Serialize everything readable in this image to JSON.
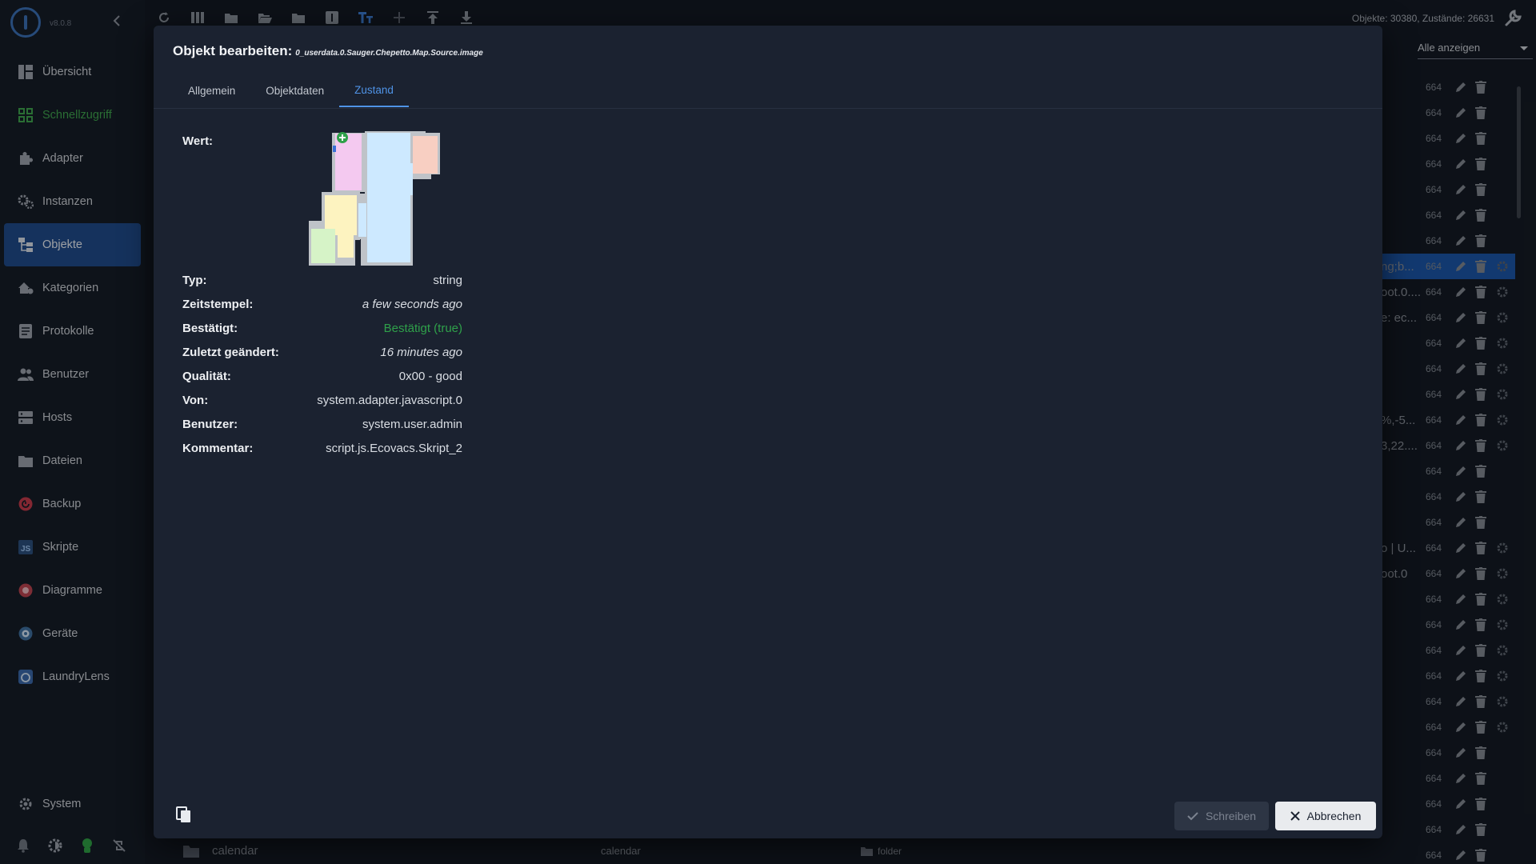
{
  "app": {
    "version": "v8.0.8"
  },
  "sidebar": {
    "items": [
      {
        "label": "Übersicht",
        "icon": "dashboard-icon"
      },
      {
        "label": "Schnellzugriff",
        "icon": "grid-icon"
      },
      {
        "label": "Adapter",
        "icon": "puzzle-icon"
      },
      {
        "label": "Instanzen",
        "icon": "gears-icon"
      },
      {
        "label": "Objekte",
        "icon": "tree-icon"
      },
      {
        "label": "Kategorien",
        "icon": "home-category-icon"
      },
      {
        "label": "Protokolle",
        "icon": "log-icon"
      },
      {
        "label": "Benutzer",
        "icon": "users-icon"
      },
      {
        "label": "Hosts",
        "icon": "server-icon"
      },
      {
        "label": "Dateien",
        "icon": "folder-icon"
      },
      {
        "label": "Backup",
        "icon": "backup-icon"
      },
      {
        "label": "Skripte",
        "icon": "js-icon"
      },
      {
        "label": "Diagramme",
        "icon": "chart-icon"
      },
      {
        "label": "Geräte",
        "icon": "devices-icon"
      },
      {
        "label": "LaundryLens",
        "icon": "laundry-icon"
      }
    ],
    "system_label": "System"
  },
  "header": {
    "stats": "Objekte: 30380, Zustände: 26631",
    "filter_value": "Alle anzeigen"
  },
  "rows": {
    "count_value": "664",
    "peeks": [
      "",
      "",
      "",
      "",
      "",
      "",
      "",
      "ng;b...",
      "oot.0....",
      "e: ec...",
      "",
      "",
      "",
      "%,-5...",
      "3,22....",
      "",
      "",
      "",
      "o | U...",
      "oot.0",
      "",
      "",
      "",
      "",
      "",
      "",
      "",
      "",
      "",
      "",
      ""
    ]
  },
  "bottom_row": {
    "name": "calendar",
    "role": "calendar",
    "type": "folder"
  },
  "dialog": {
    "title": "Objekt bearbeiten:",
    "object_id": "0_userdata.0.Sauger.Chepetto.Map.Source.image",
    "tabs": [
      "Allgemein",
      "Objektdaten",
      "Zustand"
    ],
    "active_tab": "Zustand",
    "value_label": "Wert:",
    "properties": [
      {
        "key": "Typ:",
        "value": "string",
        "style": "normal"
      },
      {
        "key": "Zeitstempel:",
        "value": "a few seconds ago",
        "style": "italic"
      },
      {
        "key": "Bestätigt:",
        "value": "Bestätigt (true)",
        "style": "ok"
      },
      {
        "key": "Zuletzt geändert:",
        "value": "16 minutes ago",
        "style": "italic"
      },
      {
        "key": "Qualität:",
        "value": "0x00 - good",
        "style": "normal"
      },
      {
        "key": "Von:",
        "value": "system.adapter.javascript.0",
        "style": "normal"
      },
      {
        "key": "Benutzer:",
        "value": "system.user.admin",
        "style": "normal"
      },
      {
        "key": "Kommentar:",
        "value": "script.js.Ecovacs.Skript_2",
        "style": "normal"
      }
    ],
    "write_label": "Schreiben",
    "cancel_label": "Abbrechen"
  },
  "colors": {
    "accent": "#4f93e6",
    "active_nav": "#1f4a8a",
    "ok": "#2fa14a",
    "selected_row": "#1b55a6"
  }
}
